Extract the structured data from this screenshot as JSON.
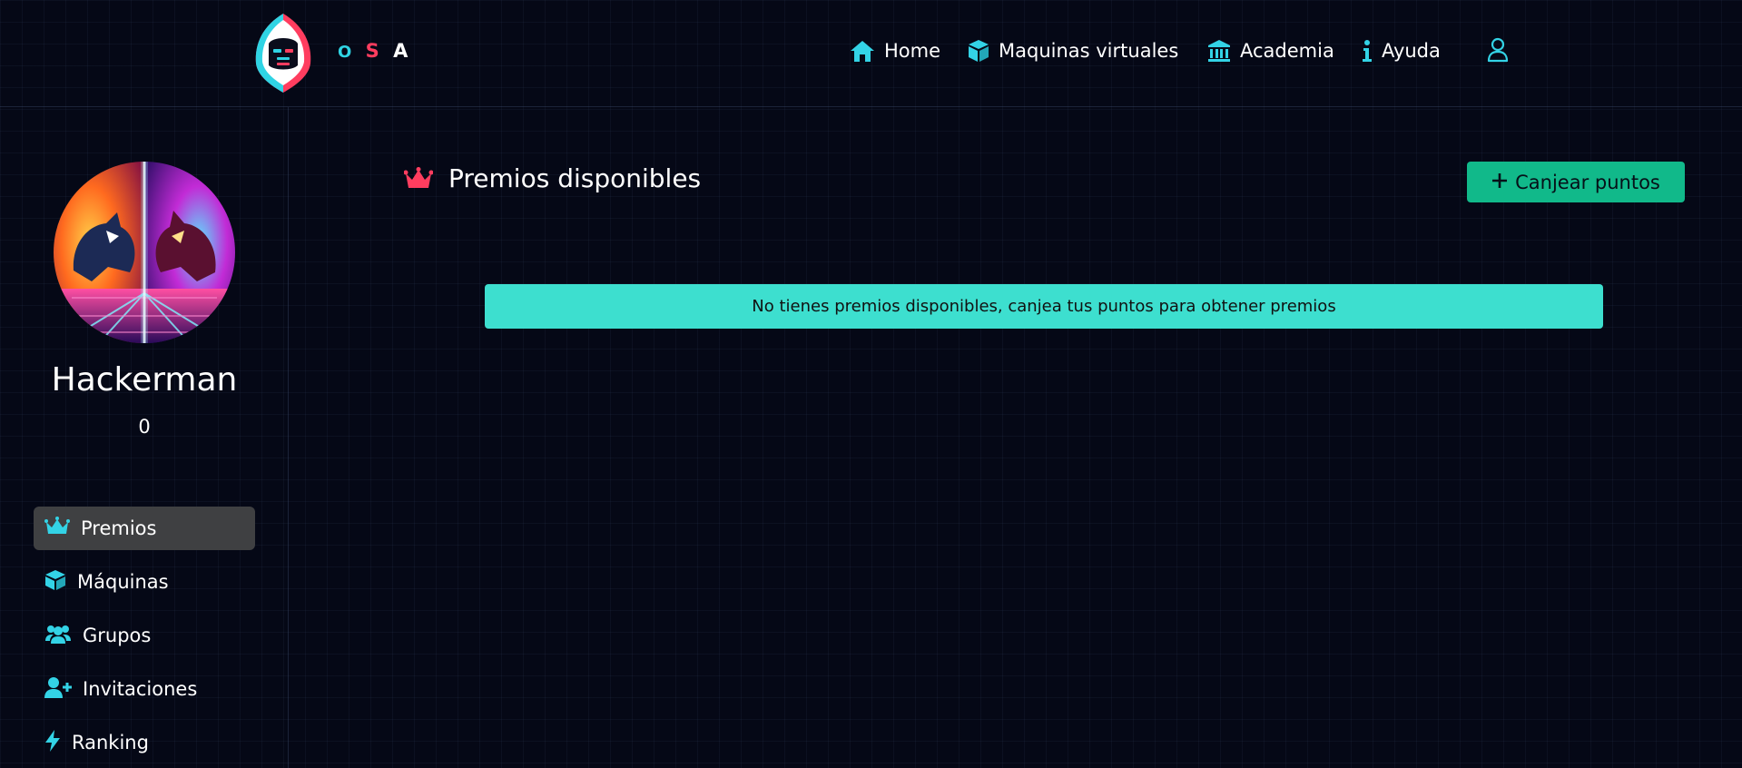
{
  "header": {
    "brand": [
      "O",
      "S",
      "A"
    ],
    "nav": [
      {
        "label": "Home",
        "icon": "home-icon"
      },
      {
        "label": "Maquinas virtuales",
        "icon": "cube-icon"
      },
      {
        "label": "Academia",
        "icon": "bank-icon"
      },
      {
        "label": "Ayuda",
        "icon": "info-icon"
      }
    ],
    "user_icon": "user-icon"
  },
  "sidebar": {
    "username": "Hackerman",
    "points": "0",
    "items": [
      {
        "label": "Premios",
        "icon": "crown-icon",
        "active": true
      },
      {
        "label": "Máquinas",
        "icon": "cube-icon",
        "active": false
      },
      {
        "label": "Grupos",
        "icon": "users-icon",
        "active": false
      },
      {
        "label": "Invitaciones",
        "icon": "user-plus-icon",
        "active": false
      },
      {
        "label": "Ranking",
        "icon": "bolt-icon",
        "active": false
      }
    ]
  },
  "main": {
    "title": "Premios disponibles",
    "title_icon": "crown-icon",
    "redeem_button": "Canjear puntos",
    "empty_message": "No tienes premios disponibles, canjea tus puntos para obtener premios"
  },
  "colors": {
    "background": "#050816",
    "accent_cyan": "#33d3e6",
    "accent_pink": "#ff3d5f",
    "button_green": "#11b98a",
    "alert_teal": "#3ddfcf",
    "active_item": "#3f4042"
  }
}
